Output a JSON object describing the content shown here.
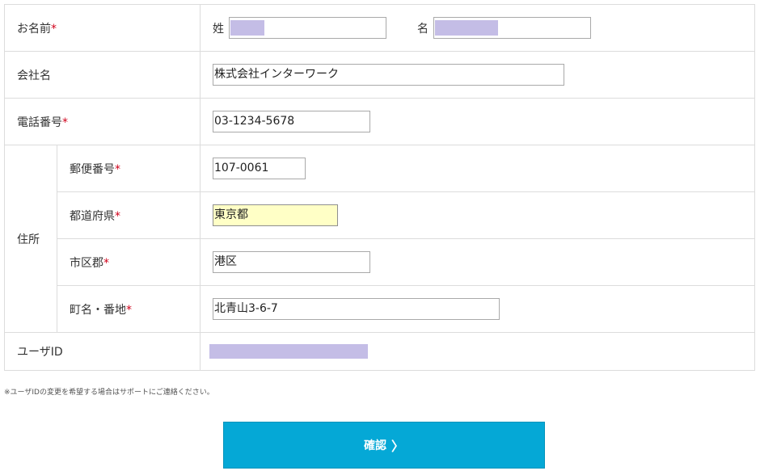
{
  "form": {
    "name": {
      "label": "お名前",
      "required": "*",
      "sei_label": "姓",
      "mei_label": "名"
    },
    "company": {
      "label": "会社名",
      "value": "株式会社インターワーク"
    },
    "phone": {
      "label": "電話番号",
      "required": "*",
      "value": "03-1234-5678"
    },
    "address": {
      "group_label": "住所",
      "postal": {
        "label": "郵便番号",
        "required": "*",
        "value": "107-0061"
      },
      "prefecture": {
        "label": "都道府県",
        "required": "*",
        "value": "東京都"
      },
      "city": {
        "label": "市区郡",
        "required": "*",
        "value": "港区"
      },
      "street": {
        "label": "町名・番地",
        "required": "*",
        "value": "北青山3-6-7"
      }
    },
    "user_id": {
      "label": "ユーザID"
    }
  },
  "note": "※ユーザIDの変更を希望する場合はサポートにご連絡ください。",
  "confirm_button": {
    "label": "確認",
    "icon": "chevron-right-icon",
    "color": "#05a8d6"
  }
}
